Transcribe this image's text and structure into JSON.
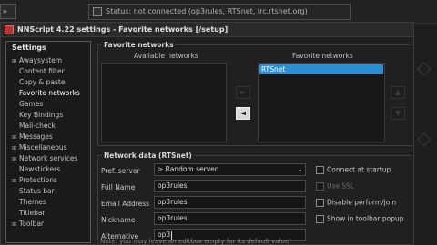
{
  "background_app": {
    "tab_label": "»",
    "status_window_title": "Status: not connected (op3rules, RTSnet, irc.rtsnet.org)"
  },
  "dialog": {
    "title": "NNScript 4.22 settings - Favorite networks [/setup]"
  },
  "sidebar": {
    "header": "Settings",
    "items": [
      {
        "label": "Awaysystem",
        "expandable": true
      },
      {
        "label": "Content filter",
        "expandable": false
      },
      {
        "label": "Copy & paste",
        "expandable": false
      },
      {
        "label": "Favorite networks",
        "expandable": false,
        "selected": true
      },
      {
        "label": "Games",
        "expandable": false
      },
      {
        "label": "Key Bindings",
        "expandable": false
      },
      {
        "label": "Mail-check",
        "expandable": false
      },
      {
        "label": "Messages",
        "expandable": true
      },
      {
        "label": "Miscellaneous",
        "expandable": true
      },
      {
        "label": "Network services",
        "expandable": true
      },
      {
        "label": "Newstickers",
        "expandable": false
      },
      {
        "label": "Protections",
        "expandable": true
      },
      {
        "label": "Status bar",
        "expandable": false
      },
      {
        "label": "Themes",
        "expandable": false
      },
      {
        "label": "Titlebar",
        "expandable": false
      },
      {
        "label": "Toolbar",
        "expandable": true
      }
    ]
  },
  "favorite_networks": {
    "group_title": "Favorite networks",
    "available_header": "Available networks",
    "favorite_header": "Favorite networks",
    "available_items": [],
    "favorite_items": [
      "RTSnet"
    ],
    "buttons": {
      "move_right": "►",
      "move_left": "◄",
      "move_up": "▲",
      "move_down": "▼"
    }
  },
  "network_data": {
    "group_title": "Network data (RTSnet)",
    "pref_server_label": "Pref. server",
    "pref_server_value": "> Random server",
    "full_name_label": "Full Name",
    "full_name_value": "op3rules",
    "email_label": "Email Address",
    "email_value": "op3rules",
    "nickname_label": "Nickname",
    "nickname_value": "op3rules",
    "alternative_label": "Alternative",
    "alternative_value": "op3",
    "checkboxes": [
      {
        "label": "Connect at startup",
        "checked": false,
        "enabled": true
      },
      {
        "label": "Use SSL",
        "checked": false,
        "enabled": false
      },
      {
        "label": "Disable perform/join",
        "checked": false,
        "enabled": true
      },
      {
        "label": "Show in toolbar popup",
        "checked": false,
        "enabled": true
      }
    ],
    "note": "Note: you may leave an editbox empty for its default value!"
  }
}
